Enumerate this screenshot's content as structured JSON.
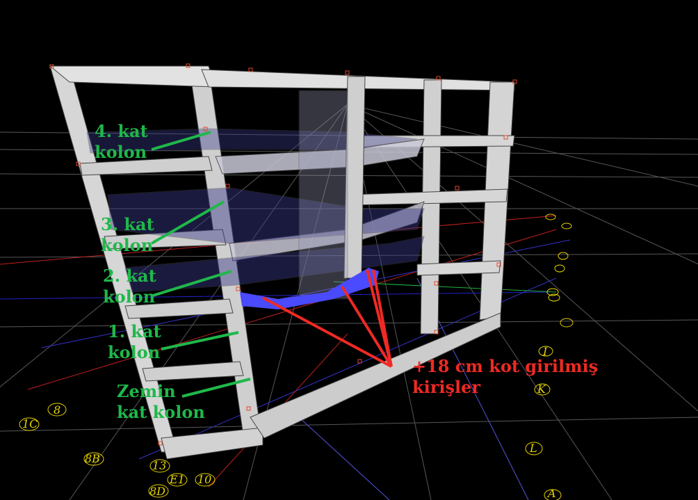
{
  "viewport": {
    "background": "#000000",
    "grid_color": "#7a7a7a",
    "structure_color": "#d9d9d9",
    "highlight_beam_color": "#4a4aff"
  },
  "annotations": {
    "floor4": "4. kat\nkolon",
    "floor3": "3. kat\nkolon",
    "floor2": "2. kat\nkolon",
    "floor1": "1. kat\nkolon",
    "ground": "Zemin\nkat kolon",
    "beam_note": "+18 cm kot girilmiş\nkirişler",
    "label_color": "#1fb84a",
    "note_color": "#ef2a24"
  },
  "axis_markers": {
    "labels": [
      "1C",
      "8",
      "8B",
      "13",
      "E1",
      "10",
      "8D",
      "I",
      "K",
      "L",
      "A"
    ],
    "color": "#e6d300"
  }
}
